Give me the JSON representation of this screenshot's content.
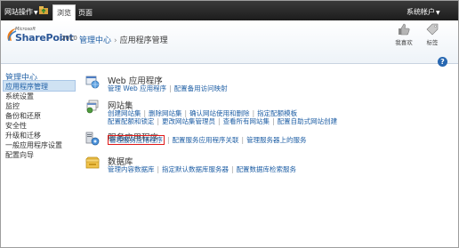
{
  "ribbon": {
    "site_actions": "网站操作",
    "tab_browse": "浏览",
    "tab_page": "页面",
    "account": "系统帐户"
  },
  "header": {
    "logo_microsoft": "Microsoft",
    "logo_product": "SharePoint",
    "logo_year": "2010",
    "breadcrumb_root": "管理中心",
    "breadcrumb_sep": "›",
    "breadcrumb_current": "应用程序管理",
    "like_it_label": "我喜欢",
    "tags_notes_label": "标签"
  },
  "quick_launch": {
    "heading": "管理中心",
    "items": [
      "应用程序管理",
      "系统设置",
      "监控",
      "备份和还原",
      "安全性",
      "升级和迁移",
      "一般应用程序设置",
      "配置向导"
    ]
  },
  "sections": {
    "web_apps": {
      "title": "Web 应用程序",
      "row1": [
        "管理 Web 应用程序",
        "配置备用访问映射"
      ]
    },
    "site_collections": {
      "title": "网站集",
      "row1": [
        "创建网站集",
        "删除网站集",
        "确认网站使用和删除",
        "指定配额模板"
      ],
      "row2": [
        "配置配额和锁定",
        "更改网站集管理员",
        "查看所有网站集",
        "配置自助式网站创建"
      ]
    },
    "service_apps": {
      "title": "服务应用程序",
      "row1": [
        "管理服务应用程序",
        "配置服务应用程序关联",
        "管理服务器上的服务"
      ]
    },
    "databases": {
      "title": "数据库",
      "row1": [
        "管理内容数据库",
        "指定默认数据库服务器",
        "配置数据库检索服务"
      ]
    }
  },
  "colors": {
    "link": "#1f5fa5",
    "highlight_border": "#e01a1a",
    "ribbon_bg": "#1c1c1c"
  }
}
